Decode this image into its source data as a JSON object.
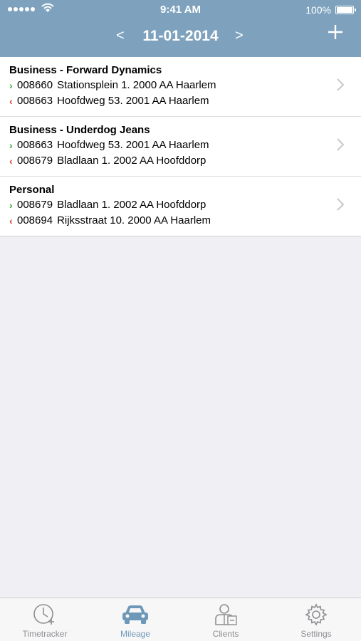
{
  "status_bar": {
    "time": "9:41 AM",
    "battery": "100%"
  },
  "nav": {
    "prev": "<",
    "date": "11-01-2014",
    "next": ">"
  },
  "trips": [
    {
      "title": "Business - Forward Dynamics",
      "out": {
        "code": "008660",
        "address": "Stationsplein 1. 2000 AA Haarlem"
      },
      "in": {
        "code": "008663",
        "address": "Hoofdweg 53. 2001 AA Haarlem"
      }
    },
    {
      "title": "Business - Underdog Jeans",
      "out": {
        "code": "008663",
        "address": "Hoofdweg 53. 2001 AA Haarlem"
      },
      "in": {
        "code": "008679",
        "address": "Bladlaan 1. 2002 AA Hoofddorp"
      }
    },
    {
      "title": "Personal",
      "out": {
        "code": "008679",
        "address": "Bladlaan 1. 2002 AA Hoofddorp"
      },
      "in": {
        "code": "008694",
        "address": "Rijksstraat 10. 2000 AA Haarlem"
      }
    }
  ],
  "tabs": [
    {
      "label": "Timetracker",
      "icon": "clock-icon"
    },
    {
      "label": "Mileage",
      "icon": "car-icon",
      "active": true
    },
    {
      "label": "Clients",
      "icon": "clients-icon"
    },
    {
      "label": "Settings",
      "icon": "gear-icon"
    }
  ],
  "colors": {
    "header": "#7ea2bd",
    "out_arrow": "#3aa53a",
    "in_arrow": "#d0453b",
    "active_tab": "#6e98b8"
  }
}
